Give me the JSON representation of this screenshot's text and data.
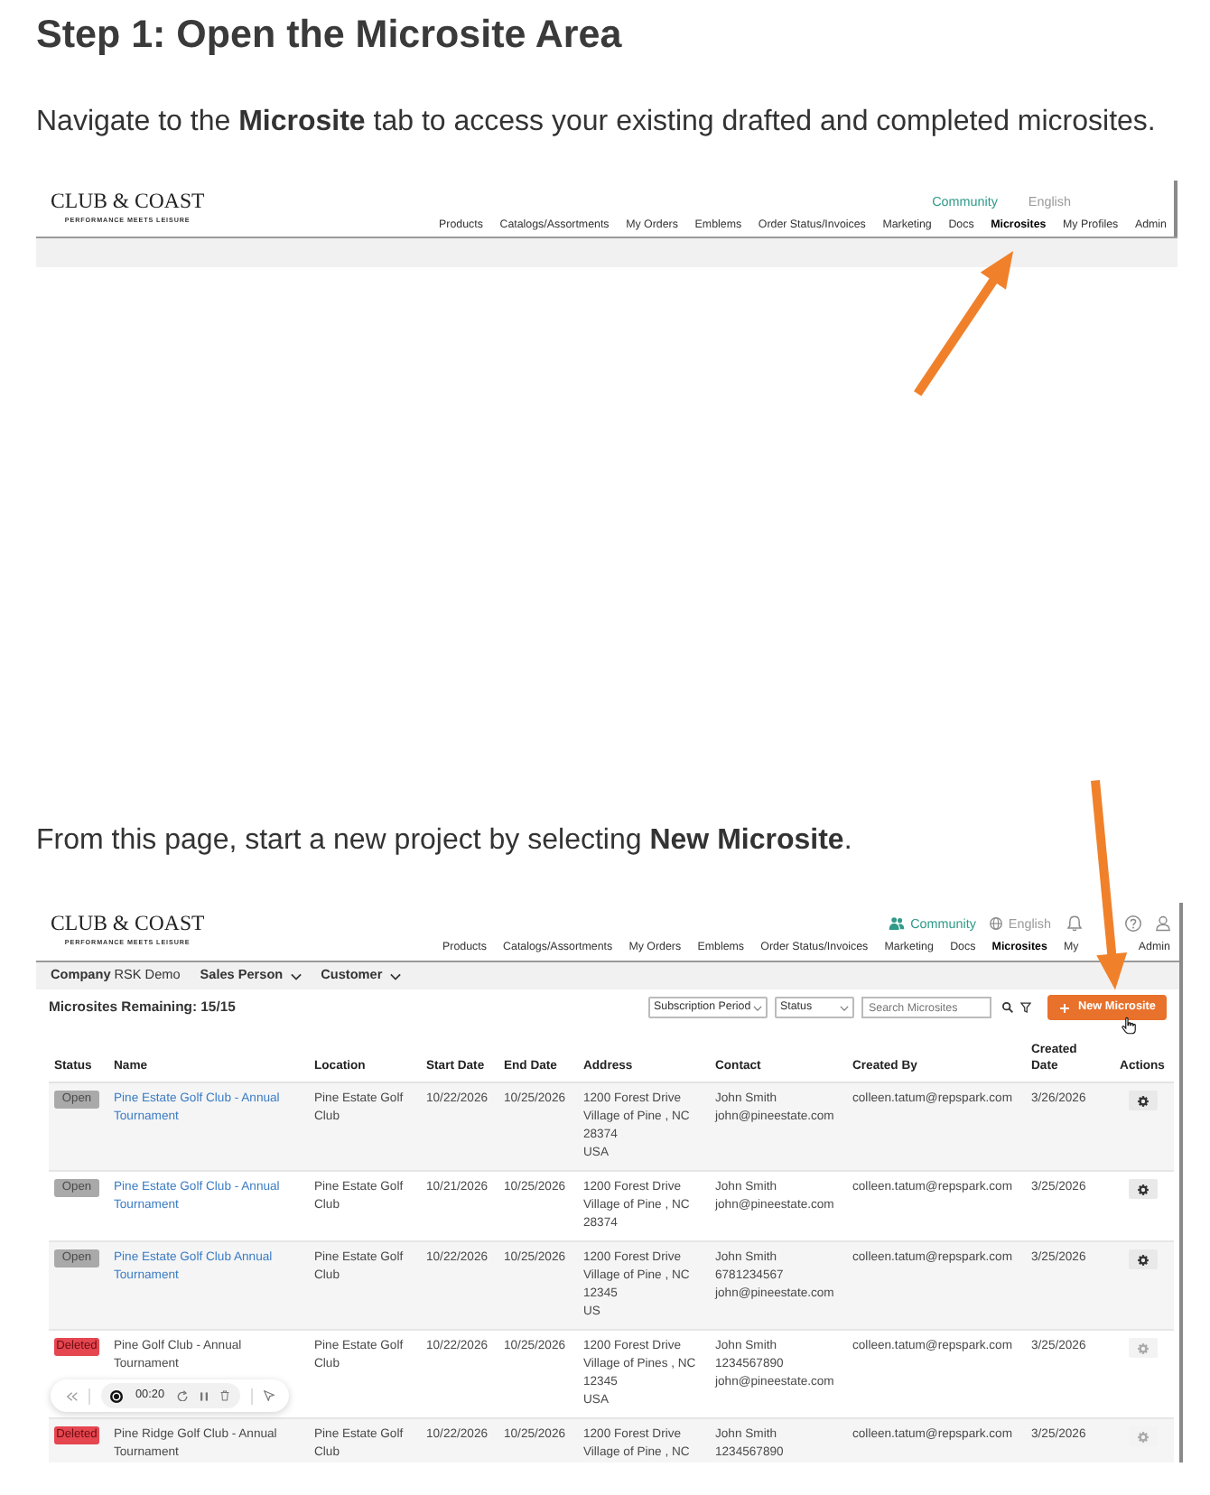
{
  "title": "Step 1: Open the Microsite Area",
  "intro": "Navigate to the **Microsite** tab to access your existing drafted and completed microsites.",
  "screenshot_1": {
    "logo": "CLUB & COAST",
    "tagline": "PERFORMANCE MEETS LEISURE",
    "top_links": [
      {
        "label": "Community",
        "kind": "community"
      },
      {
        "label": "English",
        "kind": "language"
      }
    ],
    "nav": [
      {
        "label": "Products",
        "selected": false
      },
      {
        "label": "Catalogs/Assortments",
        "selected": false
      },
      {
        "label": "My Orders",
        "selected": false
      },
      {
        "label": "Emblems",
        "selected": false
      },
      {
        "label": "Order Status/Invoices",
        "selected": false
      },
      {
        "label": "Marketing",
        "selected": false
      },
      {
        "label": "Docs",
        "selected": false
      },
      {
        "label": "Microsites",
        "selected": true
      },
      {
        "label": "My Profiles",
        "selected": false
      },
      {
        "label": "Admin",
        "selected": false
      }
    ]
  },
  "instruction": "From this page, start a new project by selecting **New Microsite**.",
  "screenshot_2": {
    "logo": "CLUB & COAST",
    "tagline": "PERFORMANCE MEETS LEISURE",
    "top_links": [
      {
        "label": "Community",
        "kind": "community"
      },
      {
        "label": "English",
        "kind": "language"
      }
    ],
    "nav": [
      {
        "label": "Products",
        "selected": false
      },
      {
        "label": "Catalogs/Assortments",
        "selected": false
      },
      {
        "label": "My Orders",
        "selected": false
      },
      {
        "label": "Emblems",
        "selected": false
      },
      {
        "label": "Order Status/Invoices",
        "selected": false
      },
      {
        "label": "Marketing",
        "selected": false
      },
      {
        "label": "Docs",
        "selected": false
      },
      {
        "label": "Microsites",
        "selected": true
      },
      {
        "label": "My",
        "selected": false
      },
      {
        "label": "Admin",
        "selected": false
      }
    ],
    "filters": [
      {
        "label": "Company",
        "value": "RSK Demo",
        "kind": "value"
      },
      {
        "label": "Sales Person",
        "kind": "dropdown"
      },
      {
        "label": "Customer",
        "kind": "dropdown"
      }
    ],
    "remaining": "Microsites Remaining: 15/15",
    "selects": [
      {
        "value": "Subscription Period"
      },
      {
        "value": "Status"
      }
    ],
    "search": {
      "placeholder": "Search Microsites"
    },
    "new_button": "New Microsite",
    "table": {
      "columns": [
        "Status",
        "Name",
        "Location",
        "Start Date",
        "End Date",
        "Address",
        "Contact",
        "Created By",
        "Created Date",
        "Actions"
      ],
      "rows": [
        {
          "status": "Open",
          "deleted": false,
          "name": "Pine Estate Golf Club - Annual Tournament",
          "location": "Pine Estate Golf Club",
          "start_date": "10/22/2026",
          "end_date": "10/25/2026",
          "address": [
            "1200 Forest Drive",
            "Village of Pine , NC",
            "28374",
            "USA"
          ],
          "contact": [
            "John Smith",
            "john@pineestate.com"
          ],
          "created_by": "colleen.tatum@repspark.com",
          "created_date": "3/26/2026"
        },
        {
          "status": "Open",
          "deleted": false,
          "name": "Pine Estate Golf Club - Annual Tournament",
          "location": "Pine Estate Golf Club",
          "start_date": "10/21/2026",
          "end_date": "10/25/2026",
          "address": [
            "1200 Forest Drive",
            "Village of Pine , NC",
            "28374"
          ],
          "contact": [
            "John Smith",
            "john@pineestate.com"
          ],
          "created_by": "colleen.tatum@repspark.com",
          "created_date": "3/25/2026"
        },
        {
          "status": "Open",
          "deleted": false,
          "name": "Pine Estate Golf Club Annual Tournament",
          "location": "Pine Estate Golf Club",
          "start_date": "10/22/2026",
          "end_date": "10/25/2026",
          "address": [
            "1200 Forest Drive",
            "Village of Pine , NC",
            "12345",
            "US"
          ],
          "contact": [
            "John Smith",
            "6781234567",
            "john@pineestate.com"
          ],
          "created_by": "colleen.tatum@repspark.com",
          "created_date": "3/25/2026"
        },
        {
          "status": "Deleted",
          "deleted": true,
          "name": "Pine Golf Club - Annual Tournament",
          "location": "Pine Estate Golf Club",
          "start_date": "10/22/2026",
          "end_date": "10/25/2026",
          "address": [
            "1200 Forest Drive",
            "Village of Pines , NC",
            "12345",
            "USA"
          ],
          "contact": [
            "John Smith",
            "1234567890",
            "john@pineestate.com"
          ],
          "created_by": "colleen.tatum@repspark.com",
          "created_date": "3/25/2026"
        },
        {
          "status": "Deleted",
          "deleted": true,
          "name": "Pine Ridge Golf Club - Annual Tournament",
          "location": "Pine Estate Golf Club",
          "start_date": "10/22/2026",
          "end_date": "10/25/2026",
          "address": [
            "1200 Forest Drive",
            "Village of Pine , NC"
          ],
          "contact": [
            "John Smith",
            "1234567890"
          ],
          "created_by": "colleen.tatum@repspark.com",
          "created_date": "3/25/2026"
        }
      ]
    },
    "recorder": {
      "time": "00:20"
    }
  }
}
